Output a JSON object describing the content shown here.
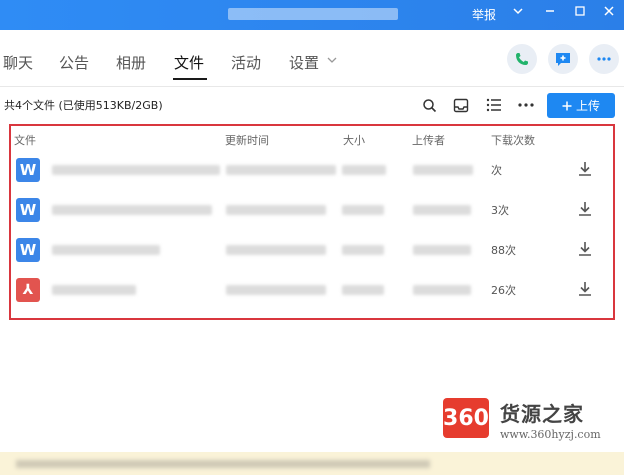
{
  "titlebar": {
    "report_label": "举报",
    "colors": {
      "bg": "#2b7fe8"
    }
  },
  "nav": {
    "tabs": [
      {
        "label": "聊天"
      },
      {
        "label": "公告"
      },
      {
        "label": "相册"
      },
      {
        "label": "文件",
        "active": true
      },
      {
        "label": "活动"
      },
      {
        "label": "设置"
      }
    ]
  },
  "toolbar": {
    "storage_text": "共4个文件 (已使用513KB/2GB)",
    "upload_label": "上传"
  },
  "table": {
    "headers": [
      "文件",
      "更新时间",
      "大小",
      "上传者",
      "下载次数"
    ],
    "rows": [
      {
        "type": "word",
        "icon_letter": "W",
        "downloads": "次"
      },
      {
        "type": "word",
        "icon_letter": "W",
        "downloads": "3次"
      },
      {
        "type": "word",
        "icon_letter": "W",
        "downloads": "88次"
      },
      {
        "type": "pdf",
        "icon_letter": "⅄",
        "downloads": "26次"
      }
    ]
  },
  "watermark": {
    "logo": "360",
    "name": "货源之家",
    "url": "www.360hyzj.com"
  }
}
